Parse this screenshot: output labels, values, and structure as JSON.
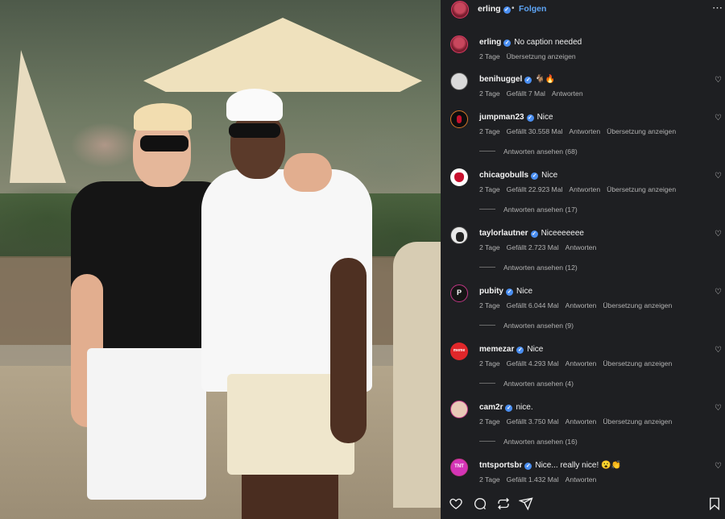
{
  "header": {
    "username": "erling",
    "separator": "•",
    "follow_label": "Folgen",
    "more_icon": "⋯"
  },
  "comments": [
    {
      "user": "erling",
      "text": "No caption needed",
      "time": "2 Tage",
      "likes": "",
      "reply": "",
      "translate": "Übersetzung anzeigen",
      "replies": ""
    },
    {
      "user": "benihuggel",
      "text": "🐐🔥",
      "time": "2 Tage",
      "likes": "Gefällt 7 Mal",
      "reply": "Antworten",
      "translate": "",
      "replies": ""
    },
    {
      "user": "jumpman23",
      "text": "Nice",
      "time": "2 Tage",
      "likes": "Gefällt 30.558 Mal",
      "reply": "Antworten",
      "translate": "Übersetzung anzeigen",
      "replies": "Antworten ansehen (68)"
    },
    {
      "user": "chicagobulls",
      "text": "Nice",
      "time": "2 Tage",
      "likes": "Gefällt 22.923 Mal",
      "reply": "Antworten",
      "translate": "Übersetzung anzeigen",
      "replies": "Antworten ansehen (17)"
    },
    {
      "user": "taylorlautner",
      "text": "Niceeeeeee",
      "time": "2 Tage",
      "likes": "Gefällt 2.723 Mal",
      "reply": "Antworten",
      "translate": "",
      "replies": "Antworten ansehen (12)"
    },
    {
      "user": "pubity",
      "text": "Nice",
      "time": "2 Tage",
      "likes": "Gefällt 6.044 Mal",
      "reply": "Antworten",
      "translate": "Übersetzung anzeigen",
      "replies": "Antworten ansehen (9)"
    },
    {
      "user": "memezar",
      "text": "Nice",
      "time": "2 Tage",
      "likes": "Gefällt 4.293 Mal",
      "reply": "Antworten",
      "translate": "Übersetzung anzeigen",
      "replies": "Antworten ansehen (4)"
    },
    {
      "user": "cam2r",
      "text": "nice.",
      "time": "2 Tage",
      "likes": "Gefällt 3.750 Mal",
      "reply": "Antworten",
      "translate": "Übersetzung anzeigen",
      "replies": "Antworten ansehen (16)"
    },
    {
      "user": "tntsportsbr",
      "text": "Nice... really nice! 😮👏",
      "time": "2 Tage",
      "likes": "Gefällt 1.432 Mal",
      "reply": "Antworten",
      "translate": "",
      "replies": ""
    }
  ],
  "icons": {
    "like": "heart-icon",
    "comment": "comment-icon",
    "share": "repost-icon",
    "send": "send-icon",
    "save": "bookmark-icon"
  },
  "colors": {
    "panel_bg": "#1e1f22",
    "follow": "#5ea5f6",
    "verified": "#4a8ef0"
  }
}
